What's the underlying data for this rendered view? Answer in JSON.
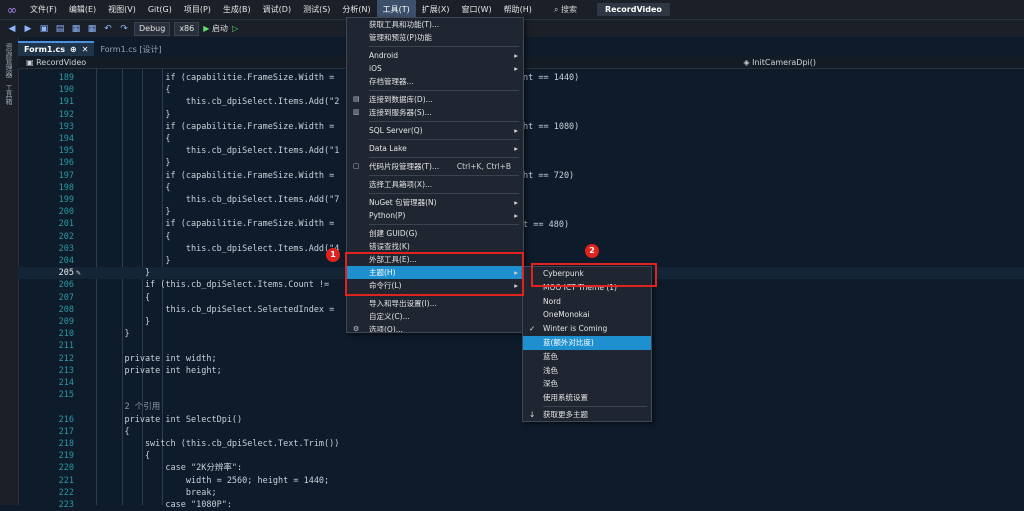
{
  "menubar": {
    "items": [
      "文件(F)",
      "编辑(E)",
      "视图(V)",
      "Git(G)",
      "项目(P)",
      "生成(B)",
      "调试(D)",
      "测试(S)",
      "分析(N)",
      "工具(T)",
      "扩展(X)",
      "窗口(W)",
      "帮助(H)"
    ],
    "search_label": "搜索",
    "app_title": "RecordVideo"
  },
  "toolbar": {
    "config": "Debug",
    "platform": "x86",
    "start_label": "启动"
  },
  "sidestrip": {
    "items": [
      "资源管理器",
      "工具箱"
    ]
  },
  "tabs": [
    {
      "label": "Form1.cs",
      "active": true
    },
    {
      "label": "Form1.cs [设计]",
      "active": false
    }
  ],
  "navbar": {
    "left": "RecordVideo",
    "right": "InitCameraDpi()"
  },
  "editor": {
    "lines": [
      {
        "n": "189",
        "t": "            if (capabilitie.FrameSize.Width ="
      },
      {
        "n": "190",
        "t": "            {"
      },
      {
        "n": "191",
        "t": "                this.cb_dpiSelect.Items.Add(\"2"
      },
      {
        "n": "192",
        "t": "            }"
      },
      {
        "n": "193",
        "t": "            if (capabilitie.FrameSize.Width ="
      },
      {
        "n": "194",
        "t": "            {"
      },
      {
        "n": "195",
        "t": "                this.cb_dpiSelect.Items.Add(\"1"
      },
      {
        "n": "196",
        "t": "            }"
      },
      {
        "n": "197",
        "t": "            if (capabilitie.FrameSize.Width ="
      },
      {
        "n": "198",
        "t": "            {"
      },
      {
        "n": "199",
        "t": "                this.cb_dpiSelect.Items.Add(\"7"
      },
      {
        "n": "200",
        "t": "            }"
      },
      {
        "n": "201",
        "t": "            if (capabilitie.FrameSize.Width ="
      },
      {
        "n": "202",
        "t": "            {"
      },
      {
        "n": "203",
        "t": "                this.cb_dpiSelect.Items.Add(\"4"
      },
      {
        "n": "204",
        "t": "            }"
      },
      {
        "n": "205",
        "t": "        }"
      },
      {
        "n": "206",
        "t": "        if (this.cb_dpiSelect.Items.Count !="
      },
      {
        "n": "207",
        "t": "        {"
      },
      {
        "n": "208",
        "t": "            this.cb_dpiSelect.SelectedIndex ="
      },
      {
        "n": "209",
        "t": "        }"
      },
      {
        "n": "210",
        "t": "    }"
      },
      {
        "n": "211",
        "t": ""
      },
      {
        "n": "212",
        "t": "    private int width;"
      },
      {
        "n": "213",
        "t": "    private int height;"
      },
      {
        "n": "214",
        "t": ""
      },
      {
        "n": "215",
        "t": ""
      },
      {
        "n": "",
        "t": "    2 个引用"
      },
      {
        "n": "216",
        "t": "    private int SelectDpi()"
      },
      {
        "n": "217",
        "t": "    {"
      },
      {
        "n": "218",
        "t": "        switch (this.cb_dpiSelect.Text.Trim())"
      },
      {
        "n": "219",
        "t": "        {"
      },
      {
        "n": "220",
        "t": "            case \"2K分辨率\":"
      },
      {
        "n": "221",
        "t": "                width = 2560; height = 1440;"
      },
      {
        "n": "222",
        "t": "                break;"
      },
      {
        "n": "223",
        "t": "            case \"1080P\":"
      }
    ],
    "right_fragments": [
      "nt == 1440)",
      "ht == 1080)",
      "ht == 720)",
      "t == 480)"
    ]
  },
  "tools_menu": {
    "items": [
      {
        "label": "获取工具和功能(T)...",
        "type": "item"
      },
      {
        "label": "管理和预览(P)功能",
        "type": "item"
      },
      {
        "type": "sep"
      },
      {
        "label": "Android",
        "type": "item",
        "submenu": true
      },
      {
        "label": "iOS",
        "type": "item",
        "submenu": true
      },
      {
        "label": "存档管理器...",
        "type": "item"
      },
      {
        "type": "sep"
      },
      {
        "label": "连接到数据库(D)...",
        "type": "item",
        "icon": "db"
      },
      {
        "label": "连接到服务器(S)...",
        "type": "item",
        "icon": "server"
      },
      {
        "type": "sep"
      },
      {
        "label": "SQL Server(Q)",
        "type": "item",
        "submenu": true
      },
      {
        "type": "sep"
      },
      {
        "label": "Data Lake",
        "type": "item",
        "submenu": true
      },
      {
        "type": "sep"
      },
      {
        "label": "代码片段管理器(T)...",
        "type": "item",
        "shortcut": "Ctrl+K, Ctrl+B",
        "icon": "snip"
      },
      {
        "type": "sep"
      },
      {
        "label": "选择工具箱项(X)...",
        "type": "item"
      },
      {
        "type": "sep"
      },
      {
        "label": "NuGet 包管理器(N)",
        "type": "item",
        "submenu": true
      },
      {
        "label": "Python(P)",
        "type": "item",
        "submenu": true
      },
      {
        "type": "sep"
      },
      {
        "label": "创建 GUID(G)",
        "type": "item"
      },
      {
        "label": "错误查找(K)",
        "type": "item"
      },
      {
        "label": "外部工具(E)...",
        "type": "item"
      },
      {
        "label": "主题(H)",
        "type": "item",
        "submenu": true,
        "selected": true
      },
      {
        "label": "命令行(L)",
        "type": "item",
        "submenu": true
      },
      {
        "type": "sep"
      },
      {
        "label": "导入和导出设置(I)...",
        "type": "item"
      },
      {
        "label": "自定义(C)...",
        "type": "item"
      },
      {
        "label": "选项(O)...",
        "type": "item",
        "icon": "gear"
      }
    ]
  },
  "theme_menu": {
    "items": [
      {
        "label": "Cyberpunk",
        "type": "item"
      },
      {
        "label": "MOO ICT Theme (1)",
        "type": "item"
      },
      {
        "label": "Nord",
        "type": "item"
      },
      {
        "label": "OneMonokai",
        "type": "item"
      },
      {
        "label": "Winter is Coming",
        "type": "item",
        "checked": true
      },
      {
        "label": "蓝(额外对比度)",
        "type": "item",
        "selected": true
      },
      {
        "label": "蓝色",
        "type": "item"
      },
      {
        "label": "浅色",
        "type": "item"
      },
      {
        "label": "深色",
        "type": "item"
      },
      {
        "label": "使用系统设置",
        "type": "item"
      },
      {
        "type": "sep"
      },
      {
        "label": "获取更多主题",
        "type": "item",
        "icon": "download"
      }
    ]
  },
  "annotations": [
    "1",
    "2"
  ],
  "colors": {
    "accent": "#1e90d0",
    "annotation": "#e0231e",
    "editor_bg": "#0d1b2a"
  }
}
